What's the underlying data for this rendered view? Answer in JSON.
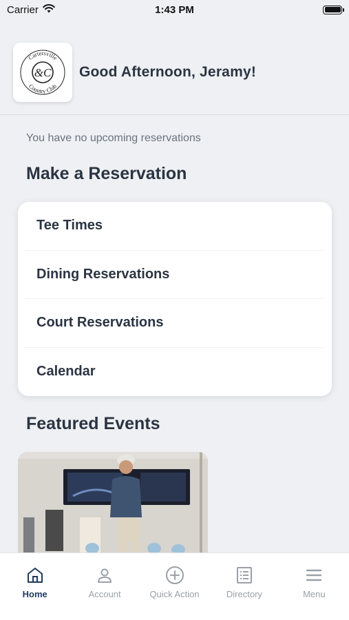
{
  "status_bar": {
    "carrier": "Carrier",
    "time": "1:43 PM"
  },
  "header": {
    "logo_alt": "Cartersville Country Club",
    "logo_text_top": "Cartersville",
    "logo_text_bottom": "Country Club",
    "logo_monogram": "&C",
    "greeting": "Good Afternoon, Jeramy!"
  },
  "reservations": {
    "status": "You have no upcoming reservations"
  },
  "make_reservation": {
    "title": "Make a Reservation",
    "items": [
      {
        "label": "Tee Times"
      },
      {
        "label": "Dining Reservations"
      },
      {
        "label": "Court Reservations"
      },
      {
        "label": "Calendar"
      }
    ]
  },
  "featured_events": {
    "title": "Featured Events"
  },
  "tab_bar": {
    "active_color": "#1f3a5c",
    "inactive_color": "#9aa0a8",
    "tabs": [
      {
        "label": "Home",
        "icon": "home-icon"
      },
      {
        "label": "Account",
        "icon": "person-icon"
      },
      {
        "label": "Quick Action",
        "icon": "plus-circle-icon"
      },
      {
        "label": "Directory",
        "icon": "list-icon"
      },
      {
        "label": "Menu",
        "icon": "hamburger-icon"
      }
    ]
  }
}
